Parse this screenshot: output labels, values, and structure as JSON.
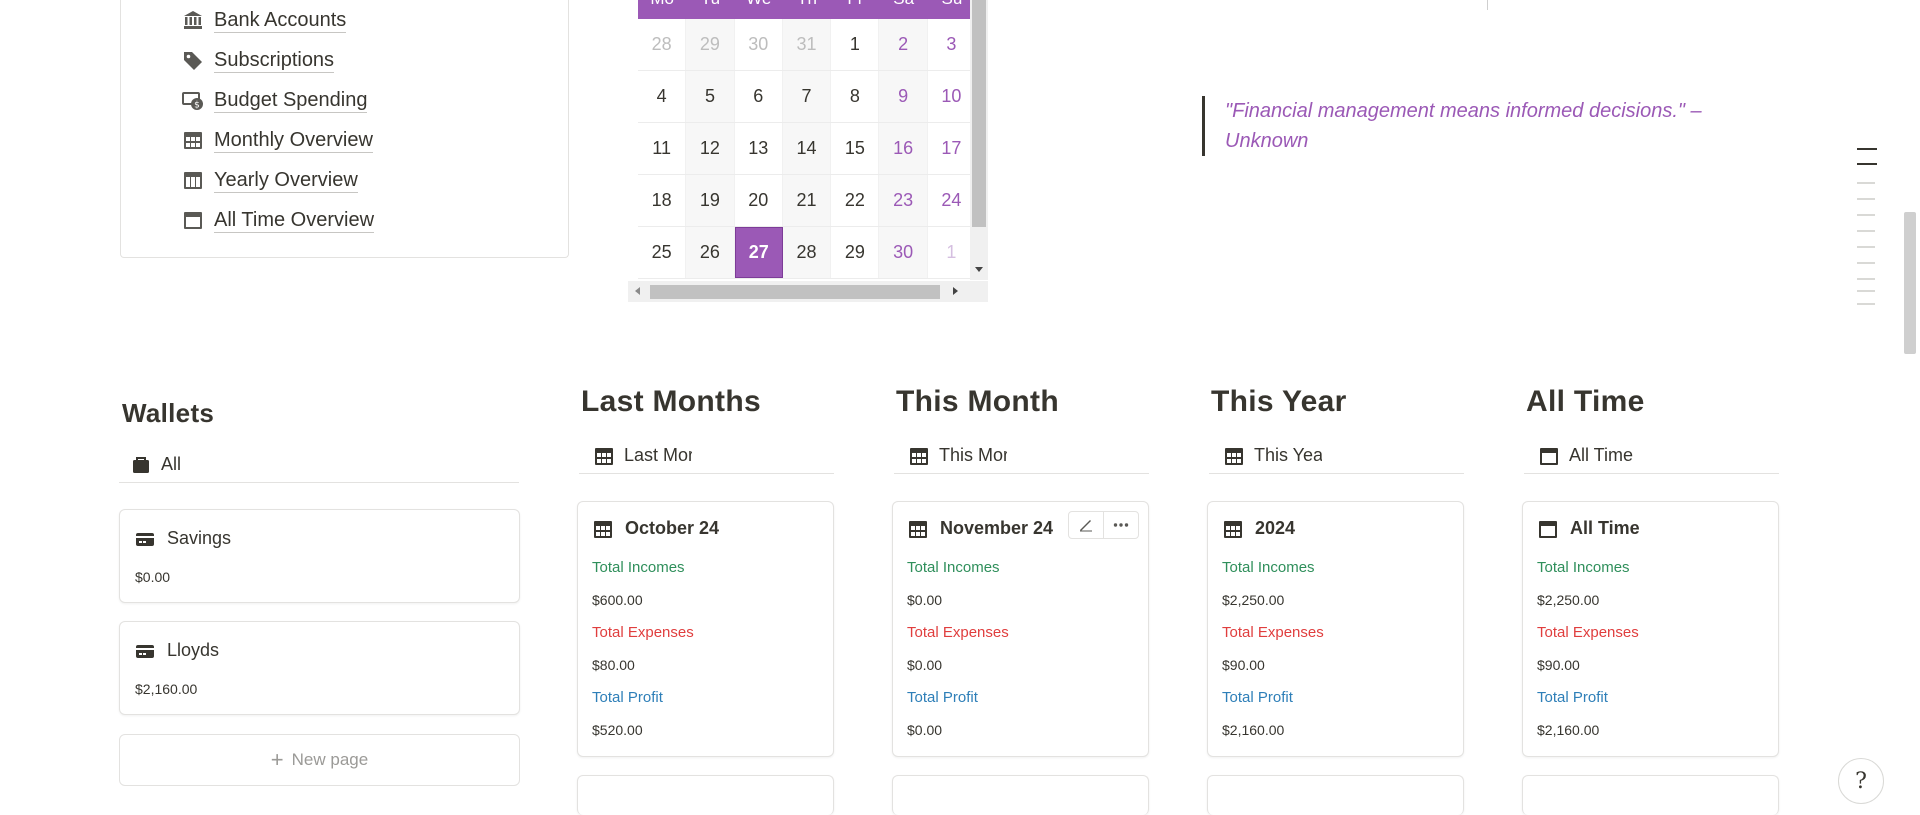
{
  "nav": {
    "items": [
      {
        "label": "Bank Accounts",
        "icon": "bank-icon"
      },
      {
        "label": "Subscriptions",
        "icon": "tag-icon"
      },
      {
        "label": "Budget Spending",
        "icon": "money-icon"
      },
      {
        "label": "Monthly Overview",
        "icon": "calendar-grid-icon"
      },
      {
        "label": "Yearly Overview",
        "icon": "calendar-grid-icon"
      },
      {
        "label": "All Time Overview",
        "icon": "calendar-icon"
      }
    ]
  },
  "calendar": {
    "weekdays": [
      "Mo",
      "Tu",
      "We",
      "Th",
      "Fr",
      "Sa",
      "Su"
    ],
    "weeks": [
      [
        "28",
        "29",
        "30",
        "31",
        "1",
        "2",
        "3"
      ],
      [
        "4",
        "5",
        "6",
        "7",
        "8",
        "9",
        "10"
      ],
      [
        "11",
        "12",
        "13",
        "14",
        "15",
        "16",
        "17"
      ],
      [
        "18",
        "19",
        "20",
        "21",
        "22",
        "23",
        "24"
      ],
      [
        "25",
        "26",
        "27",
        "28",
        "29",
        "30",
        "1"
      ]
    ],
    "today": "27",
    "accent": "#9b59b6"
  },
  "quote": {
    "text": "\"Financial management means informed decisions.\" – Unknown",
    "color": "#9b59b6"
  },
  "wallets": {
    "title": "Wallets",
    "view_label": "All",
    "cards": [
      {
        "name": "Savings",
        "amount": "$0.00"
      },
      {
        "name": "Lloyds",
        "amount": "$2,160.00"
      }
    ],
    "new_page_label": "New page"
  },
  "summaries": [
    {
      "section": "Last Months",
      "view_label": "Last Mor",
      "card_title": "October 24",
      "incomes_label": "Total Incomes",
      "incomes": "$600.00",
      "expenses_label": "Total Expenses",
      "expenses": "$80.00",
      "profit_label": "Total Profit",
      "profit": "$520.00"
    },
    {
      "section": "This Month",
      "view_label": "This Mor",
      "card_title": "November 24",
      "incomes_label": "Total Incomes",
      "incomes": "$0.00",
      "expenses_label": "Total Expenses",
      "expenses": "$0.00",
      "profit_label": "Total Profit",
      "profit": "$0.00"
    },
    {
      "section": "This Year",
      "view_label": "This Yeaı",
      "card_title": "2024",
      "incomes_label": "Total Incomes",
      "incomes": "$2,250.00",
      "expenses_label": "Total Expenses",
      "expenses": "$90.00",
      "profit_label": "Total Profit",
      "profit": "$2,160.00"
    },
    {
      "section": "All Time",
      "view_label": "All Time",
      "card_title": "All Time",
      "incomes_label": "Total Incomes",
      "incomes": "$2,250.00",
      "expenses_label": "Total Expenses",
      "expenses": "$90.00",
      "profit_label": "Total Profit",
      "profit": "$2,160.00"
    }
  ],
  "colors": {
    "income": "#2f8f5b",
    "expense": "#e03e3e",
    "profit": "#2e7fb8"
  },
  "help_label": "?"
}
